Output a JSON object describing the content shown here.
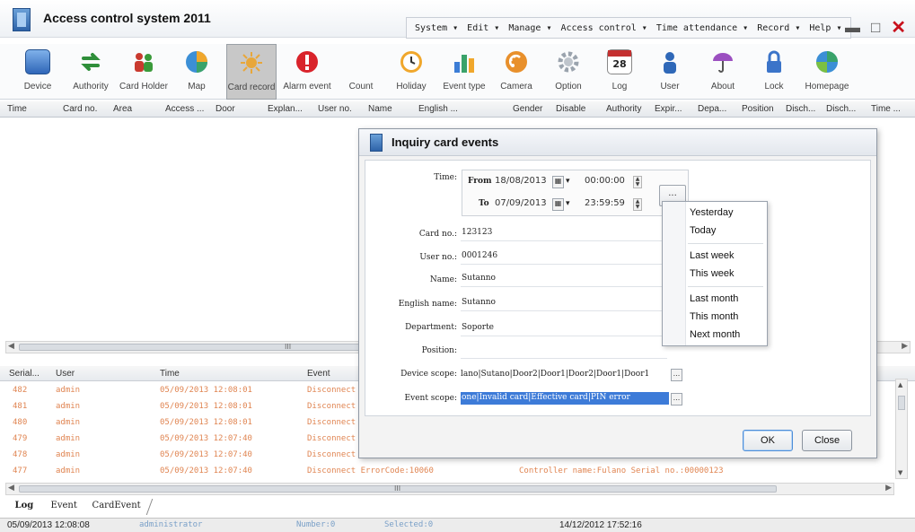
{
  "app": {
    "title": "Access control system 2011",
    "menu": [
      "System",
      "Edit",
      "Manage",
      "Access control",
      "Time attendance",
      "Record",
      "Help"
    ]
  },
  "toolbar": [
    {
      "label": "Device",
      "icon": "device-icon",
      "color": "#3f7ad0"
    },
    {
      "label": "Authority",
      "icon": "authority-arrows-icon",
      "color": "#3a9a3a"
    },
    {
      "label": "Card Holder",
      "icon": "card-holder-icon",
      "color": "#c93a2f"
    },
    {
      "label": "Map",
      "icon": "map-globe-icon",
      "color": "#e0902a"
    },
    {
      "label": "Card record",
      "icon": "card-record-icon",
      "color": "#e7a93a",
      "active": true
    },
    {
      "label": "Alarm event",
      "icon": "alarm-icon",
      "color": "#d9232b"
    },
    {
      "label": "Count",
      "icon": "count-icon",
      "color": "#ffffff"
    },
    {
      "label": "Holiday",
      "icon": "holiday-clock-icon",
      "color": "#f0a72c"
    },
    {
      "label": "Event type",
      "icon": "event-type-chart-icon",
      "color": "#3c7dd6"
    },
    {
      "label": "Camera",
      "icon": "camera-icon",
      "color": "#e8902c"
    },
    {
      "label": "Option",
      "icon": "option-gear-icon",
      "color": "#9aa3ad"
    },
    {
      "label": "Log",
      "icon": "log-calendar-icon",
      "color": "#c43030"
    },
    {
      "label": "User",
      "icon": "user-icon",
      "color": "#2f68b8"
    },
    {
      "label": "About",
      "icon": "about-umbrella-icon",
      "color": "#9b4fc0"
    },
    {
      "label": "Lock",
      "icon": "lock-icon",
      "color": "#3b74c9"
    },
    {
      "label": "Homepage",
      "icon": "homepage-globe-icon",
      "color": "#3aa36a"
    }
  ],
  "log_calendar_day": "28",
  "columns": [
    "Time",
    "Card no.",
    "Area",
    "Access ...",
    "Door",
    "Explan...",
    "User no.",
    "Name",
    "English ...",
    "Gender",
    "Disable",
    "Authority",
    "Expir...",
    "Depa...",
    "Position",
    "Disch...",
    "Disch...",
    "Time ..."
  ],
  "scroll_mark": "III",
  "log": {
    "headers": [
      "Serial...",
      "User",
      "Time",
      "Event"
    ],
    "rows": [
      {
        "serial": "482",
        "user": "admin",
        "time": "05/09/2013 12:08:01",
        "event": "Disconnect",
        "detail": ""
      },
      {
        "serial": "481",
        "user": "admin",
        "time": "05/09/2013 12:08:01",
        "event": "Disconnect",
        "detail": ""
      },
      {
        "serial": "480",
        "user": "admin",
        "time": "05/09/2013 12:08:01",
        "event": "Disconnect",
        "detail": ""
      },
      {
        "serial": "479",
        "user": "admin",
        "time": "05/09/2013 12:07:40",
        "event": "Disconnect",
        "detail": ""
      },
      {
        "serial": "478",
        "user": "admin",
        "time": "05/09/2013 12:07:40",
        "event": "Disconnect",
        "detail": ""
      },
      {
        "serial": "477",
        "user": "admin",
        "time": "05/09/2013 12:07:40",
        "event": "Disconnect ErrorCode:10060",
        "detail": "Controller name:Fulano Serial no.:00000123"
      }
    ]
  },
  "tabs": [
    "Log",
    "Event",
    "CardEvent"
  ],
  "status": {
    "time": "05/09/2013 12:08:08",
    "user": "administrator",
    "number": "Number:0",
    "selected": "Selected:0",
    "right_time": "14/12/2012 17:52:16"
  },
  "dialog": {
    "title": "Inquiry card events",
    "time_label": "Time:",
    "from_label": "From",
    "from_date": "18/08/2013",
    "from_time": "00:00:00",
    "to_label": "To",
    "to_date": "07/09/2013",
    "to_time": "23:59:59",
    "ellipsis": "...",
    "fields": [
      {
        "label": "Card no.:",
        "value": "123123"
      },
      {
        "label": "User no.:",
        "value": "0001246"
      },
      {
        "label": "Name:",
        "value": "Sutanno"
      },
      {
        "label": "English name:",
        "value": "Sutanno"
      },
      {
        "label": "Department:",
        "value": "Soporte"
      },
      {
        "label": "Position:",
        "value": ""
      }
    ],
    "device_scope_label": "Device scope:",
    "device_scope_value": "lano|Sutano|Door2|Door1|Door2|Door1|Door1",
    "event_scope_label": "Event scope:",
    "event_scope_value": "one|Invalid card|Effective card|PIN error",
    "ok": "OK",
    "close": "Close"
  },
  "popup": {
    "groups": [
      [
        "Yesterday",
        "Today"
      ],
      [
        "Last week",
        "This week"
      ],
      [
        "Last month",
        "This month",
        "Next month"
      ]
    ]
  }
}
